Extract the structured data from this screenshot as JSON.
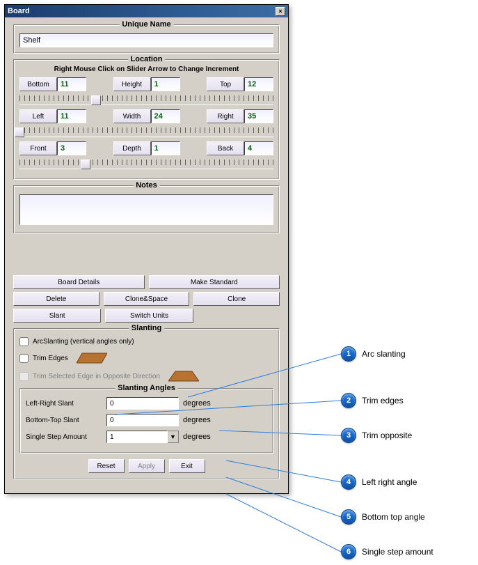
{
  "window": {
    "title": "Board"
  },
  "unique_name": {
    "legend": "Unique Name",
    "value": "Shelf"
  },
  "location": {
    "legend": "Location",
    "hint": "Right Mouse Click on Slider Arrow to Change Increment",
    "rows": [
      {
        "a_label": "Bottom",
        "a_val": "11",
        "m_label": "Height",
        "m_val": "1",
        "b_label": "Top",
        "b_val": "12",
        "thumb": 30
      },
      {
        "a_label": "Left",
        "a_val": "11",
        "m_label": "Width",
        "m_val": "24",
        "b_label": "Right",
        "b_val": "35",
        "thumb": 0
      },
      {
        "a_label": "Front",
        "a_val": "3",
        "m_label": "Depth",
        "m_val": "1",
        "b_label": "Back",
        "b_val": "4",
        "thumb": 26
      }
    ]
  },
  "notes": {
    "legend": "Notes",
    "value": ""
  },
  "buttons": {
    "details": "Board Details",
    "make_std": "Make Standard",
    "delete": "Delete",
    "clone_space": "Clone&Space",
    "clone": "Clone",
    "slant": "Slant",
    "switch_units": "Switch Units"
  },
  "slanting": {
    "legend": "Slanting",
    "arc": "ArcSlanting (vertical angles only)",
    "trim_edges": "Trim Edges",
    "trim_opposite": "Trim Selected Edge in Opposite Direction",
    "angles_legend": "Slanting Angles",
    "lr_label": "Left-Right Slant",
    "lr_val": "0",
    "bt_label": "Bottom-Top Slant",
    "bt_val": "0",
    "step_label": "Single Step Amount",
    "step_val": "1",
    "degrees": "degrees",
    "reset": "Reset",
    "apply": "Apply",
    "exit": "Exit"
  },
  "callouts": [
    {
      "n": "1",
      "text": "Arc slanting"
    },
    {
      "n": "2",
      "text": "Trim edges"
    },
    {
      "n": "3",
      "text": "Trim opposite"
    },
    {
      "n": "4",
      "text": "Left right angle"
    },
    {
      "n": "5",
      "text": "Bottom top angle"
    },
    {
      "n": "6",
      "text": "Single step amount"
    }
  ]
}
